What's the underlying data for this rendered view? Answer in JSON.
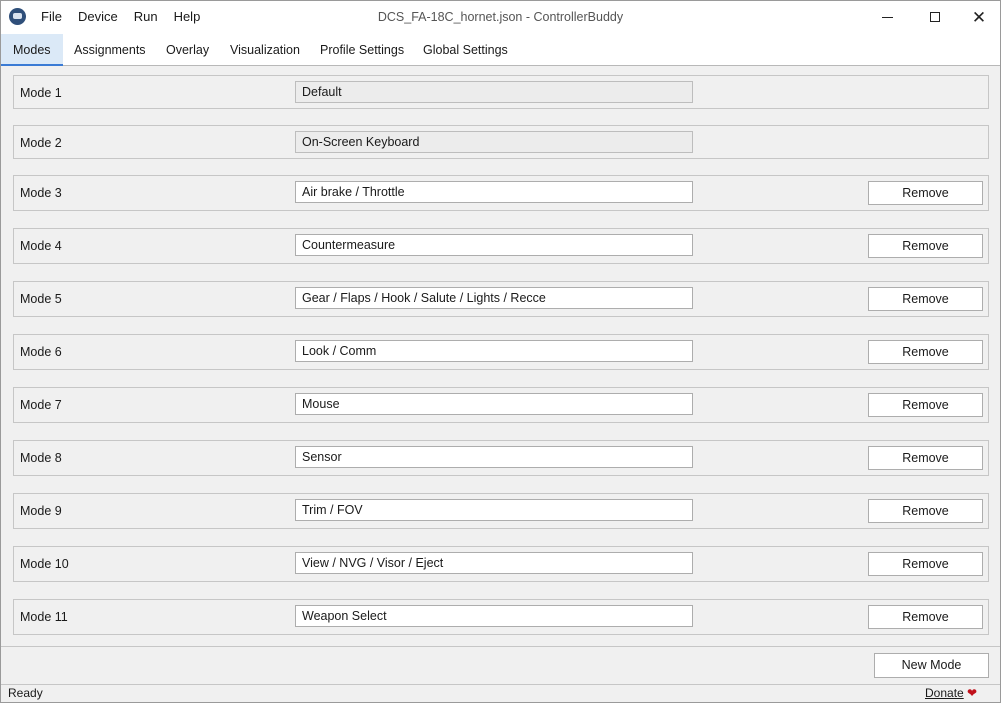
{
  "window": {
    "title": "DCS_FA-18C_hornet.json - ControllerBuddy",
    "icon": "app-joystick-icon"
  },
  "menu": [
    "File",
    "Device",
    "Run",
    "Help"
  ],
  "tabs": [
    {
      "label": "Modes",
      "active": true
    },
    {
      "label": "Assignments",
      "active": false
    },
    {
      "label": "Overlay",
      "active": false
    },
    {
      "label": "Visualization",
      "active": false
    },
    {
      "label": "Profile Settings",
      "active": false
    },
    {
      "label": "Global Settings",
      "active": false
    }
  ],
  "modes": [
    {
      "label": "Mode 1",
      "value": "Default",
      "editable": false,
      "removable": false
    },
    {
      "label": "Mode 2",
      "value": "On-Screen Keyboard",
      "editable": false,
      "removable": false
    },
    {
      "label": "Mode 3",
      "value": "Air brake / Throttle",
      "editable": true,
      "removable": true
    },
    {
      "label": "Mode 4",
      "value": "Countermeasure",
      "editable": true,
      "removable": true
    },
    {
      "label": "Mode 5",
      "value": "Gear / Flaps / Hook / Salute / Lights / Recce",
      "editable": true,
      "removable": true
    },
    {
      "label": "Mode 6",
      "value": "Look / Comm",
      "editable": true,
      "removable": true
    },
    {
      "label": "Mode 7",
      "value": "Mouse",
      "editable": true,
      "removable": true
    },
    {
      "label": "Mode 8",
      "value": "Sensor",
      "editable": true,
      "removable": true
    },
    {
      "label": "Mode 9",
      "value": "Trim / FOV",
      "editable": true,
      "removable": true
    },
    {
      "label": "Mode 10",
      "value": "View / NVG / Visor / Eject",
      "editable": true,
      "removable": true
    },
    {
      "label": "Mode 11",
      "value": "Weapon Select",
      "editable": true,
      "removable": true
    }
  ],
  "remove_label": "Remove",
  "new_mode_label": "New Mode",
  "status": {
    "text": "Ready",
    "donate_label": "Donate",
    "heart_color": "#c0101a"
  },
  "colors": {
    "active_tab_bg": "#dbe9f7",
    "active_tab_underline": "#3a7bd5"
  }
}
